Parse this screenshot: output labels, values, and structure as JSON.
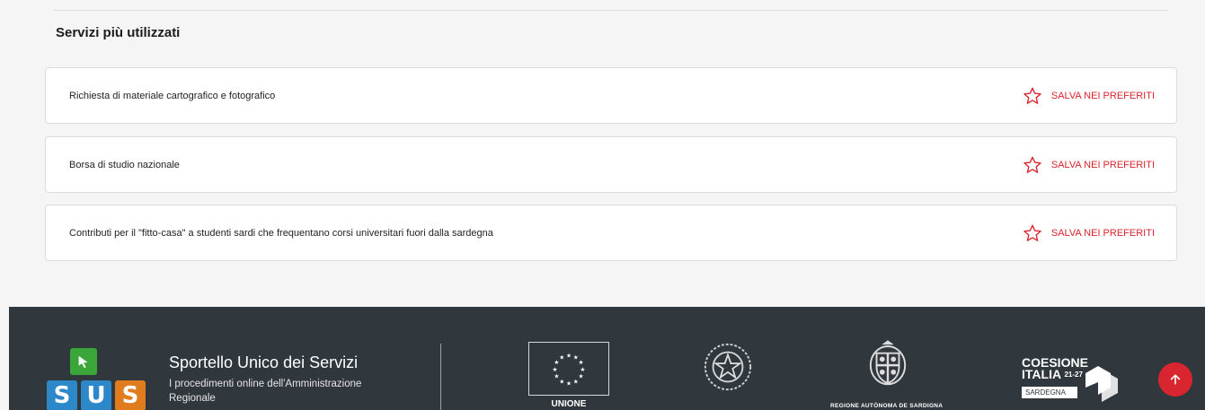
{
  "section": {
    "title": "Servizi più utilizzati"
  },
  "services": [
    {
      "title": "Richiesta di materiale cartografico e fotografico",
      "action": "SALVA NEI PREFERITI"
    },
    {
      "title": "Borsa di studio nazionale",
      "action": "SALVA NEI PREFERITI"
    },
    {
      "title": "Contributi per il \"fitto-casa\" a studenti sardi che frequentano corsi universitari fuori dalla sardegna",
      "action": "SALVA NEI PREFERITI"
    }
  ],
  "footer": {
    "brand": {
      "title": "Sportello Unico dei Servizi",
      "subtitle": "I procedimenti online dell'Amministrazione Regionale",
      "logo_letters": [
        "S",
        "U",
        "S"
      ]
    },
    "partners": {
      "eu_label": "UNIONE EUROPEA",
      "ras_label": "REGIONE AUTÒNOMA DE SARDIGNA",
      "coesione_line1": "COESIONE",
      "coesione_line2": "ITALIA",
      "coesione_years": "21-27",
      "coesione_tag": "SARDEGNA"
    }
  },
  "colors": {
    "accent": "#d9252f",
    "footer_bg": "#30373d",
    "page_bg": "#f5f5f5",
    "sus_green": "#3aa63a",
    "sus_blue": "#2d88c9",
    "sus_orange": "#e07b1e"
  },
  "icons": {
    "favorite": "star-outline-icon",
    "back_to_top": "arrow-up-icon"
  }
}
